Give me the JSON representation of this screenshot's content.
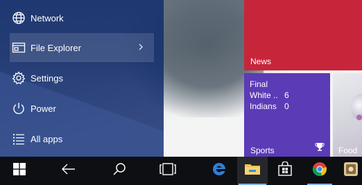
{
  "start_menu": {
    "items": [
      {
        "label": "Network",
        "icon": "globe-icon"
      },
      {
        "label": "File Explorer",
        "icon": "file-explorer-icon"
      },
      {
        "label": "Settings",
        "icon": "gear-icon"
      },
      {
        "label": "Power",
        "icon": "power-icon"
      },
      {
        "label": "All apps",
        "icon": "list-icon"
      }
    ]
  },
  "tiles": {
    "news": {
      "label": "News",
      "color": "#c7253a"
    },
    "sports": {
      "label": "Sports",
      "color": "#5b3bb6",
      "status": "Final",
      "teams": [
        {
          "name": "White ..",
          "score": "6"
        },
        {
          "name": "Indians",
          "score": "0"
        }
      ]
    },
    "food": {
      "label": "Food"
    }
  },
  "taskbar": {
    "buttons": [
      "windows-logo-icon",
      "back-arrow-icon",
      "search-icon",
      "task-view-icon",
      "edge-icon",
      "file-explorer-icon",
      "store-icon",
      "chrome-icon",
      "app-icon"
    ],
    "accent": "#7fb2e6"
  }
}
